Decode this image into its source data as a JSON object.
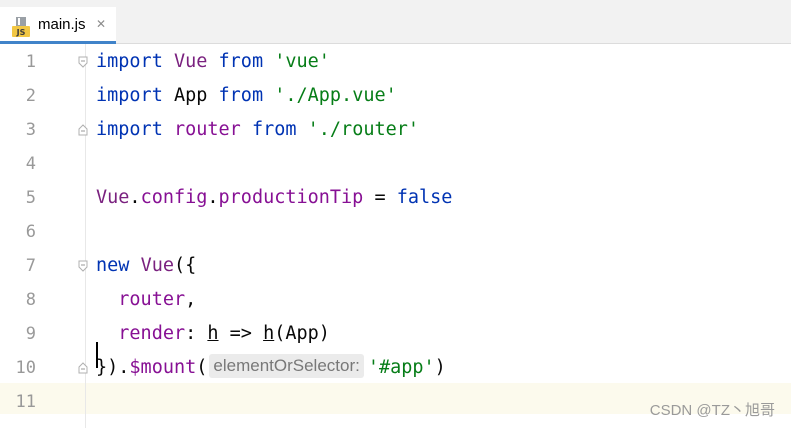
{
  "tab": {
    "file_name": "main.js",
    "icon_label": "JS",
    "close_glyph": "✕"
  },
  "gutter": {
    "line_numbers": [
      "1",
      "2",
      "3",
      "4",
      "5",
      "6",
      "7",
      "8",
      "9",
      "10",
      "11"
    ]
  },
  "code": {
    "l1": {
      "kw": "import",
      "name": "Vue",
      "from": "from",
      "str": "'vue'"
    },
    "l2": {
      "kw": "import",
      "name": "App",
      "from": "from",
      "str": "'./App.vue'"
    },
    "l3": {
      "kw": "import",
      "name": "router",
      "from": "from",
      "str": "'./router'"
    },
    "l5": {
      "obj": "Vue",
      "dot1": ".",
      "p1": "config",
      "dot2": ".",
      "p2": "productionTip",
      "eq": " = ",
      "val": "false"
    },
    "l7": {
      "kw": "new",
      "cls": "Vue",
      "punc": "({"
    },
    "l8": {
      "prop": "router",
      "punc": ","
    },
    "l9": {
      "prop": "render",
      "colon": ": ",
      "arg": "h",
      "arrow": " => ",
      "fn": "h",
      "args": "(App)"
    },
    "l10": {
      "punc1": "}).",
      "method": "$mount",
      "paren": "(",
      "hint": "elementOrSelector:",
      "str": "'#app'",
      "close": ")"
    }
  },
  "watermark": "CSDN @TZ丶旭哥",
  "colors": {
    "keyword": "#0033b3",
    "class": "#7a217f",
    "string": "#067d17",
    "property": "#871094",
    "tab_underline": "#4083c9",
    "current_line": "#fcfaed"
  }
}
